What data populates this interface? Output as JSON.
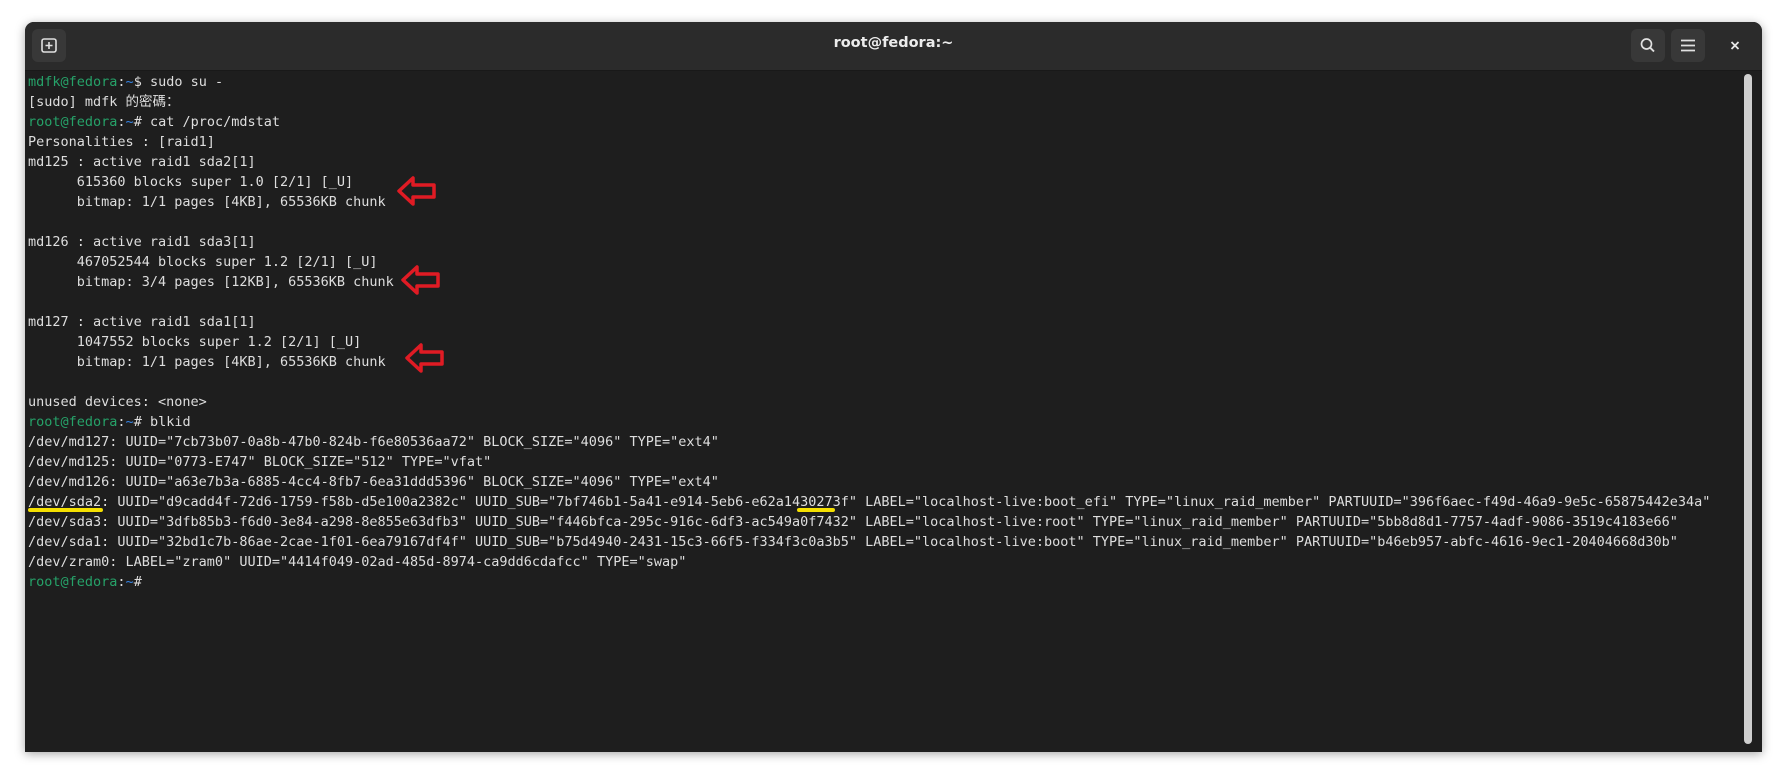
{
  "window": {
    "title": "root@fedora:~",
    "new_tab_icon": "new-tab-icon",
    "search_icon": "search-icon",
    "menu_icon": "hamburger-menu-icon",
    "close_icon": "close-icon"
  },
  "colors": {
    "terminal_bg": "#1e1e1e",
    "prompt_user": "#26a269",
    "prompt_path": "#3584e4",
    "annotation_arrow": "#e01b24",
    "highlight": "#f5e000"
  },
  "terminal": {
    "lines": [
      {
        "user": "mdfk@fedora",
        "sep": ":",
        "path": "~",
        "rest": "$ sudo su -"
      },
      {
        "text": "[sudo] mdfk 的密碼："
      },
      {
        "user": "root@fedora",
        "sep": ":",
        "path": "~",
        "rest": "# cat /proc/mdstat"
      },
      {
        "text": "Personalities : [raid1]"
      },
      {
        "text": "md125 : active raid1 sda2[1]"
      },
      {
        "text": "      615360 blocks super 1.0 [2/1] [_U]"
      },
      {
        "text": "      bitmap: 1/1 pages [4KB], 65536KB chunk"
      },
      {
        "text": ""
      },
      {
        "text": "md126 : active raid1 sda3[1]"
      },
      {
        "text": "      467052544 blocks super 1.2 [2/1] [_U]"
      },
      {
        "text": "      bitmap: 3/4 pages [12KB], 65536KB chunk"
      },
      {
        "text": ""
      },
      {
        "text": "md127 : active raid1 sda1[1]"
      },
      {
        "text": "      1047552 blocks super 1.2 [2/1] [_U]"
      },
      {
        "text": "      bitmap: 1/1 pages [4KB], 65536KB chunk"
      },
      {
        "text": ""
      },
      {
        "text": "unused devices: <none>"
      },
      {
        "user": "root@fedora",
        "sep": ":",
        "path": "~",
        "rest": "# blkid"
      },
      {
        "text": "/dev/md127: UUID=\"7cb73b07-0a8b-47b0-824b-f6e80536aa72\" BLOCK_SIZE=\"4096\" TYPE=\"ext4\""
      },
      {
        "text": "/dev/md125: UUID=\"0773-E747\" BLOCK_SIZE=\"512\" TYPE=\"vfat\""
      },
      {
        "text": "/dev/md126: UUID=\"a63e7b3a-6885-4cc4-8fb7-6ea31ddd5396\" BLOCK_SIZE=\"4096\" TYPE=\"ext4\""
      },
      {
        "text": "/dev/sda2: UUID=\"d9cadd4f-72d6-1759-f58b-d5e100a2382c\" UUID_SUB=\"7bf746b1-5a41-e914-5eb6-e62a1430273f\" LABEL=\"localhost-live:boot_efi\" TYPE=\"linux_raid_member\" PARTUUID=\"396f6aec-f49d-46a9-9e5c-65875442e34a\""
      },
      {
        "text": "/dev/sda3: UUID=\"3dfb85b3-f6d0-3e84-a298-8e855e63dfb3\" UUID_SUB=\"f446bfca-295c-916c-6df3-ac549a0f7432\" LABEL=\"localhost-live:root\" TYPE=\"linux_raid_member\" PARTUUID=\"5bb8d8d1-7757-4adf-9086-3519c4183e66\""
      },
      {
        "text": "/dev/sda1: UUID=\"32bd1c7b-86ae-2cae-1f01-6ea79167df4f\" UUID_SUB=\"b75d4940-2431-15c3-66f5-f334f3c0a3b5\" LABEL=\"localhost-live:boot\" TYPE=\"linux_raid_member\" PARTUUID=\"b46eb957-abfc-4616-9ec1-20404668d30b\""
      },
      {
        "text": "/dev/zram0: LABEL=\"zram0\" UUID=\"4414f049-02ad-485d-8974-ca9dd6cdafcc\" TYPE=\"swap\""
      },
      {
        "user": "root@fedora",
        "sep": ":",
        "path": "~",
        "rest": "#"
      }
    ]
  },
  "annotations": {
    "arrow_icon": "left-arrow-icon",
    "underline_icon": "highlight-underline"
  }
}
